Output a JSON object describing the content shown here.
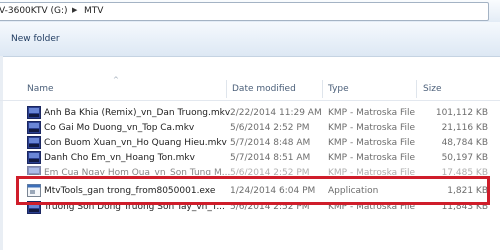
{
  "address": {
    "drive": "V-3600KTV (G:)",
    "folder": "MTV"
  },
  "toolbar": {
    "new_folder_label": "New folder"
  },
  "columns": {
    "name": "Name",
    "date": "Date modified",
    "type": "Type",
    "size": "Size"
  },
  "files": [
    {
      "name": "Anh Ba Khia (Remix)_vn_Dan Truong.mkv",
      "date": "2/22/2014 11:29 AM",
      "type": "KMP - Matroska File",
      "size": "101,112 KB",
      "icon": "kmp-video-icon"
    },
    {
      "name": "Co Gai Mo Duong_vn_Top Ca.mkv",
      "date": "5/6/2014 2:52 PM",
      "type": "KMP - Matroska File",
      "size": "21,116 KB",
      "icon": "kmp-video-icon"
    },
    {
      "name": "Con Buom Xuan_vn_Ho Quang Hieu.mkv",
      "date": "5/7/2014 8:48 AM",
      "type": "KMP - Matroska File",
      "size": "48,784 KB",
      "icon": "kmp-video-icon"
    },
    {
      "name": "Danh Cho Em_vn_Hoang Ton.mkv",
      "date": "5/7/2014 8:51 AM",
      "type": "KMP - Matroska File",
      "size": "50,197 KB",
      "icon": "kmp-video-icon"
    },
    {
      "name": "Em Cua Ngay Hom Qua_vn_Son Tung M...",
      "date": "5/6/2014 2:52 PM",
      "type": "KMP - Matroska File",
      "size": "17,485 KB",
      "icon": "kmp-video-icon"
    },
    {
      "name": "MtvTools_gan trong_from8050001.exe",
      "date": "1/24/2014 6:04 PM",
      "type": "Application",
      "size": "1,821 KB",
      "icon": "application-icon"
    },
    {
      "name": "Truong Son Dong Truong Son Tay_vn_T...",
      "date": "5/6/2014 2:52 PM",
      "type": "KMP - Matroska File",
      "size": "11,843 KB",
      "icon": "kmp-video-icon"
    }
  ],
  "colors": {
    "highlight": "#cf1d2a",
    "toolbar_text": "#1e3a5f",
    "header_text": "#4c607a"
  }
}
